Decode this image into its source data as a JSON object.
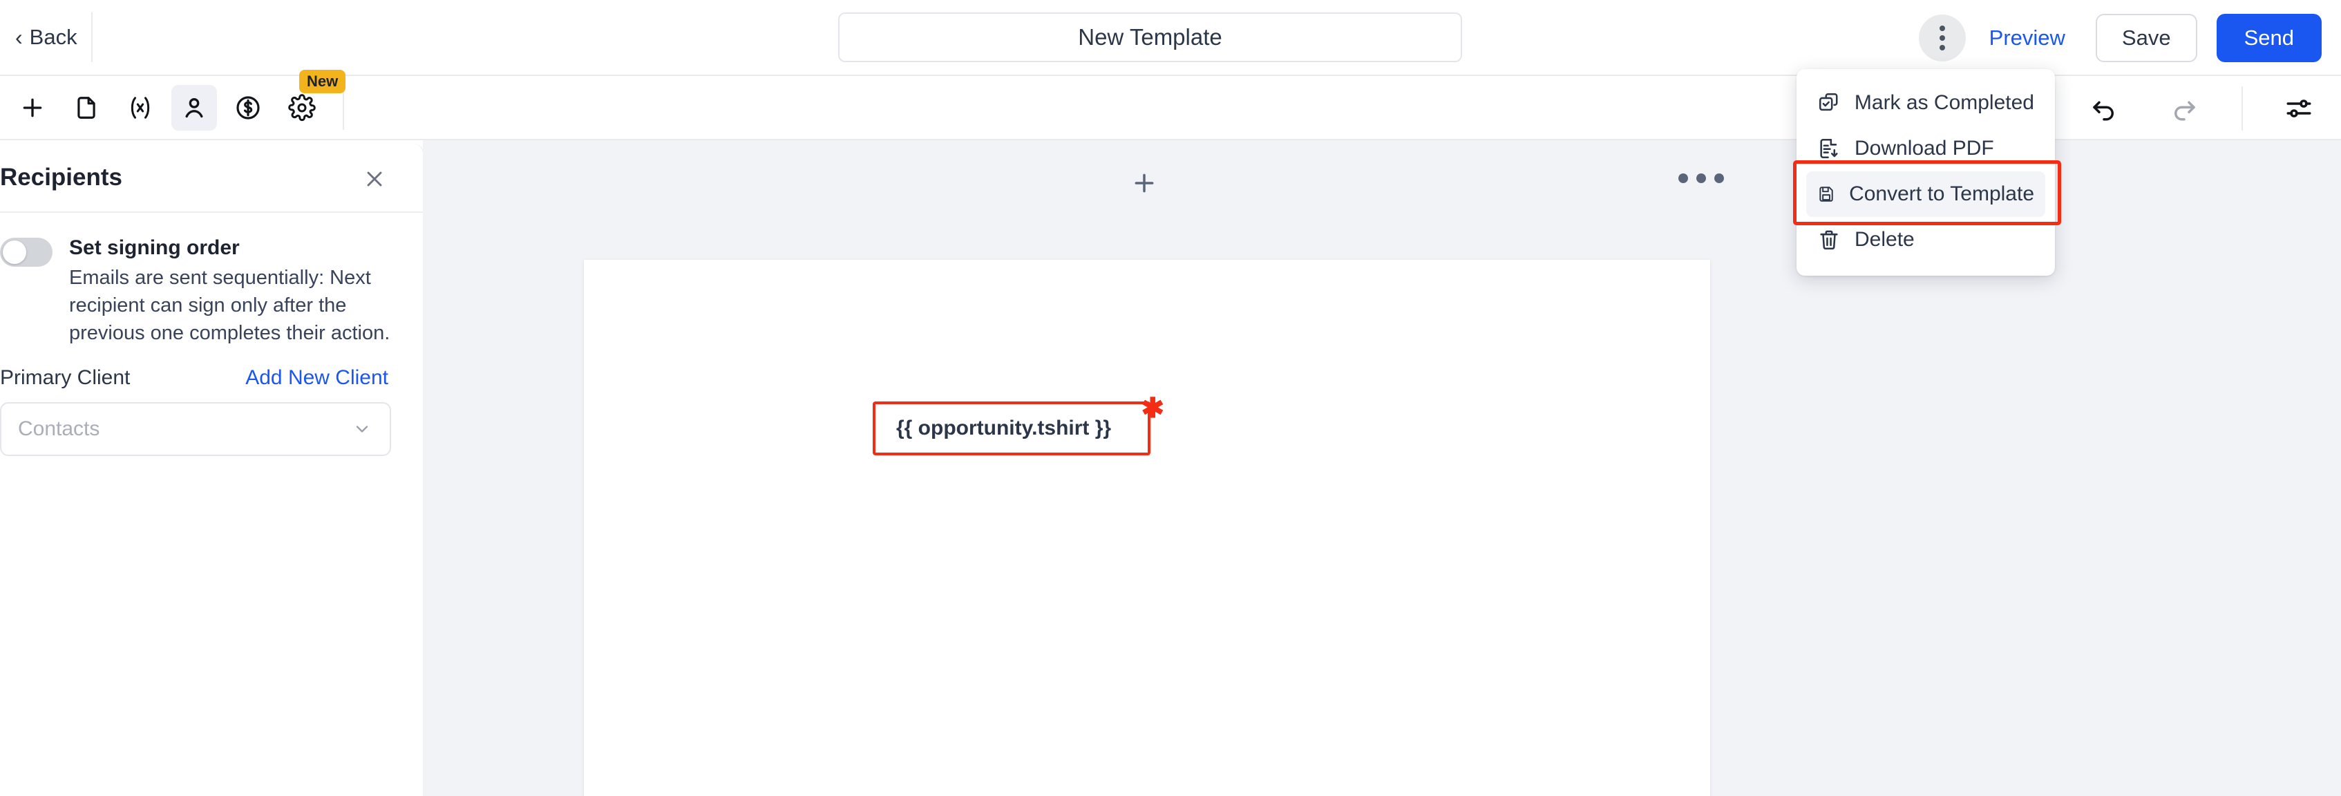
{
  "header": {
    "back_label": "Back",
    "back_icon": "chevron-left-icon",
    "title_value": "New Template",
    "title_placeholder": "Document name",
    "kebab_icon": "more-vertical-icon",
    "preview_label": "Preview",
    "save_label": "Save",
    "send_label": "Send",
    "accent_blue": "#1a56f0"
  },
  "toolbar": {
    "tools": [
      {
        "name": "add-element-button",
        "icon": "plus-icon",
        "active": false
      },
      {
        "name": "document-tool-button",
        "icon": "file-icon",
        "active": false
      },
      {
        "name": "variable-tool-button",
        "icon": "variable-fx-icon",
        "active": false
      },
      {
        "name": "recipients-tool-button",
        "icon": "person-icon",
        "active": true
      },
      {
        "name": "payment-tool-button",
        "icon": "dollar-circle-icon",
        "active": false
      },
      {
        "name": "settings-tool-button",
        "icon": "gear-icon",
        "active": false,
        "badge": "New"
      }
    ],
    "badge_label": "New",
    "badge_color": "#f3b31c",
    "undo_icon": "undo-icon",
    "redo_icon": "redo-icon",
    "redo_disabled": true,
    "sliders_icon": "sliders-icon"
  },
  "sidebar": {
    "title": "Recipients",
    "close_icon": "close-icon",
    "signing_order": {
      "label": "Set signing order",
      "description": "Emails are sent sequentially: Next recipient can sign only after the previous one completes their action.",
      "enabled": false
    },
    "client_label": "Primary Client",
    "add_client_label": "Add New Client",
    "contacts_placeholder": "Contacts",
    "contacts_value": "",
    "chevron_icon": "chevron-down-icon"
  },
  "canvas": {
    "add_page_icon": "plus-icon",
    "page_menu_icon": "more-horizontal-icon",
    "merge_field": {
      "text": "{{ opportunity.tshirt }}",
      "required_marker": "✱",
      "border_color": "#f32c13"
    }
  },
  "dropdown": {
    "items": [
      {
        "label": "Mark as Completed",
        "icon": "copy-check-icon",
        "highlighted": false
      },
      {
        "label": "Download PDF",
        "icon": "file-download-icon",
        "highlighted": false
      },
      {
        "label": "Convert to Template",
        "icon": "save-floppy-icon",
        "highlighted": true
      },
      {
        "label": "Delete",
        "icon": "trash-icon",
        "highlighted": false
      }
    ],
    "highlight_ring_color": "#f32c13"
  }
}
